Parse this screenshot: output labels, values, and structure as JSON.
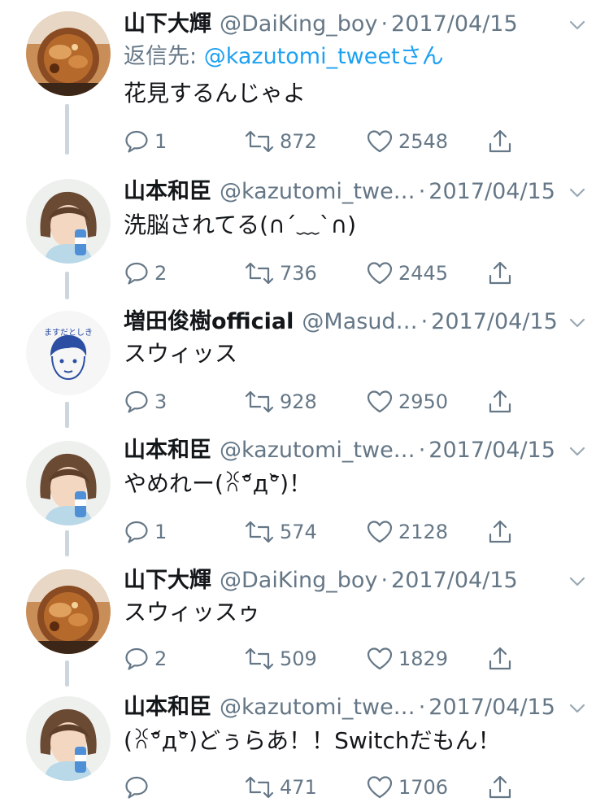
{
  "colors": {
    "text": "#14171a",
    "muted": "#657786",
    "link": "#1da1f2",
    "line": "#ccd6dd"
  },
  "tweets": [
    {
      "name": "山下大輝",
      "handle": "@DaiKing_boy",
      "sep": "·",
      "date": "2017/04/15",
      "reply_label": "返信先: ",
      "reply_mention": "@kazutomi_tweetさん",
      "text": "花見するんじゃよ",
      "replies": "1",
      "retweets": "872",
      "likes": "2548",
      "avatar": "food-photo"
    },
    {
      "name": "山本和臣",
      "handle": "@kazutomi_twe…",
      "sep": "·",
      "date": "2017/04/15",
      "text": "洗脳されてる(∩´﹏`∩)",
      "replies": "2",
      "retweets": "736",
      "likes": "2445",
      "avatar": "person-photo"
    },
    {
      "name": "増田俊樹official",
      "handle": "@Masud…",
      "sep": "·",
      "date": "2017/04/15",
      "text": "スウィッス",
      "replies": "3",
      "retweets": "928",
      "likes": "2950",
      "avatar": "drawn-face",
      "avatar_text": "ますだとしき"
    },
    {
      "name": "山本和臣",
      "handle": "@kazutomi_twe…",
      "sep": "·",
      "date": "2017/04/15",
      "text": "やめれー(ꐦ°᷄д°᷅)！",
      "replies": "1",
      "retweets": "574",
      "likes": "2128",
      "avatar": "person-photo"
    },
    {
      "name": "山下大輝",
      "handle": "@DaiKing_boy",
      "sep": "·",
      "date": "2017/04/15",
      "text": "スウィッスゥ",
      "replies": "2",
      "retweets": "509",
      "likes": "1829",
      "avatar": "food-photo"
    },
    {
      "name": "山本和臣",
      "handle": "@kazutomi_twe…",
      "sep": "·",
      "date": "2017/04/15",
      "text": "(ꐦ°᷄д°᷅)どぅらあ！！Switchだもん！",
      "replies": "",
      "retweets": "471",
      "likes": "1706",
      "avatar": "person-photo"
    }
  ],
  "icons": {
    "reply": "speech-bubble-icon",
    "retweet": "retweet-arrows-icon",
    "like": "heart-outline-icon",
    "share": "share-upload-icon",
    "menu": "chevron-down-icon"
  }
}
